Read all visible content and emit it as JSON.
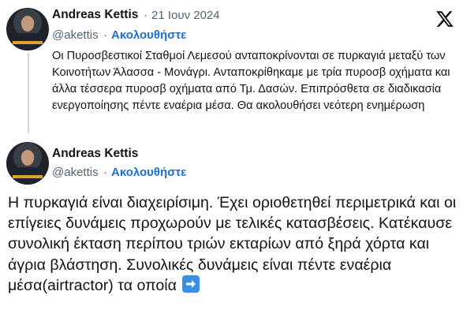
{
  "tweet1": {
    "name": "Andreas Kettis",
    "separator": "·",
    "date": "21 Ιουν 2024",
    "handle": "@akettis",
    "dot": "·",
    "follow_label": "Ακολουθήστε",
    "text": "Οι Πυροσβεστικοί Σταθμοί Λεμεσού ανταποκρίνονται σε πυρκαγιά μεταξύ των Κοινοτήτων Άλασσα - Μονάγρι.  Ανταποκρίθηκαμε με τρία πυροσβ οχήματα και άλλα τέσσερα πυροσβ οχήματα από Τμ. Δασών. Επιπρόσθετα σε διαδικασία ενεργοποίησης πέντε εναέρια μέσα. Θα ακολουθήσει νεότερη ενημέρωση"
  },
  "tweet2": {
    "name": "Andreas Kettis",
    "handle": "@akettis",
    "dot": "·",
    "follow_label": "Ακολουθήστε",
    "text": "Η πυρκαγιά είναι διαχειρίσιμη. Έχει οριοθετηθεί περιμετρικά και οι επίγειες δυνάμεις προχωρούν με τελικές κατασβέσεις. Κατέκαυσε συνολική έκταση περίπου τριών εκταρίων από ξηρά χόρτα και άγρια βλάστηση. Συνολικές δυνάμεις είναι πέντε εναέρια μέσα(airtractor) τα οποία"
  },
  "icons": {
    "logo": "x-logo-icon",
    "emoji": "right-arrow-emoji-icon"
  }
}
